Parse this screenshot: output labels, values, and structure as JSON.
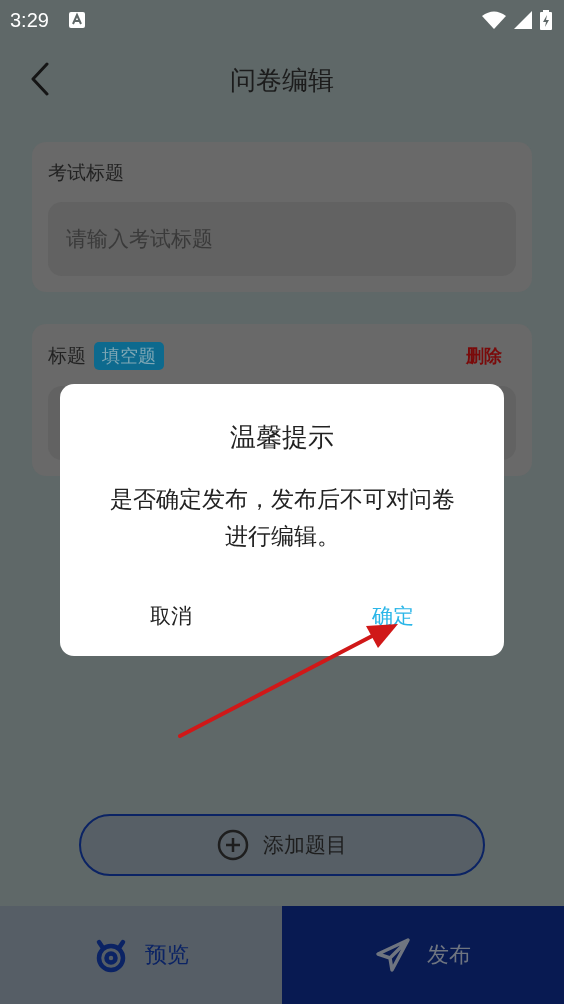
{
  "status_bar": {
    "time": "3:29"
  },
  "header": {
    "title": "问卷编辑"
  },
  "exam_title_card": {
    "label": "考试标题",
    "placeholder": "请输入考试标题"
  },
  "questions": [
    {
      "label": "标题",
      "type_tag": "填空题",
      "delete": "删除"
    }
  ],
  "add_button": {
    "label": "添加题目"
  },
  "bottom_bar": [
    {
      "kind": "preview",
      "label": "预览"
    },
    {
      "kind": "publish",
      "label": "发布"
    }
  ],
  "dialog": {
    "title": "温馨提示",
    "message": "是否确定发布，发布后不可对问卷进行编辑。",
    "buttons": [
      {
        "kind": "cancel",
        "label": "取消"
      },
      {
        "kind": "confirm",
        "label": "确定"
      }
    ]
  }
}
